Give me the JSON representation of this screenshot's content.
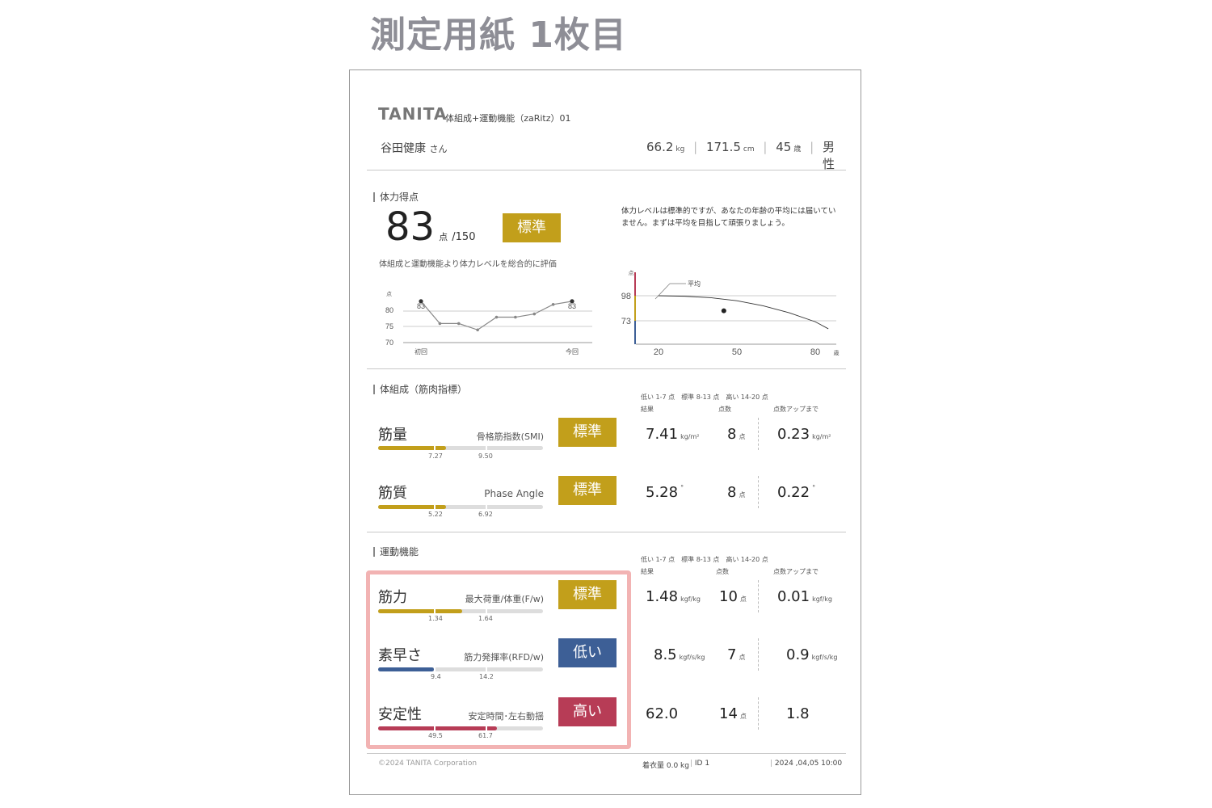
{
  "title": "測定用紙 1枚目",
  "header": {
    "brand": "TANITA",
    "product": "体組成+運動機能（zaRitz）01",
    "name": "谷田健康",
    "honorific": "さん",
    "weight": "66.2",
    "weight_unit": "kg",
    "height": "171.5",
    "height_unit": "cm",
    "age": "45",
    "age_unit": "歳",
    "sex": "男性"
  },
  "score": {
    "section": "体力得点",
    "value": "83",
    "unit": "点",
    "max": "/150",
    "badge": "標準",
    "desc": "体組成と運動機能より体力レベルを総合的に評価",
    "comment": "体力レベルは標準的ですが、あなたの年齢の平均には届いていません。まずは平均を目指して頑張りましょう。"
  },
  "chart_data": [
    {
      "type": "line",
      "ylabel": "点",
      "ylim": [
        70,
        85
      ],
      "yticks": [
        "80",
        "75",
        "70"
      ],
      "x_first": "初回",
      "x_last": "今回",
      "label_first": "83",
      "label_last": "83",
      "values": [
        83,
        76,
        76,
        74,
        78,
        78,
        79,
        82,
        83
      ],
      "color": "#888888"
    },
    {
      "type": "line",
      "ylabel": "点",
      "xlabel": "歳",
      "xticks": [
        "20",
        "50",
        "80"
      ],
      "yticks": [
        "98",
        "73"
      ],
      "xlim": [
        15,
        85
      ],
      "ylim": [
        48,
        122
      ],
      "annotation": "平均",
      "series": [
        {
          "x": [
            20,
            30,
            40,
            50,
            60,
            70,
            80,
            85
          ],
          "values": [
            98,
            97.5,
            96,
            93,
            88,
            81,
            72,
            65
          ]
        }
      ],
      "point": {
        "x": 45,
        "y": 83
      },
      "band_colors": [
        "#b73c56",
        "#c29f1b",
        "#3d5f96"
      ]
    }
  ],
  "body": {
    "section": "体組成（筋肉指標）",
    "legend": "低い 1-7 点　標準 8-13 点　高い 14-20 点",
    "col_result": "結果",
    "col_points": "点数",
    "col_up": "点数アップまで",
    "rows": [
      {
        "name": "筋量",
        "sub": "骨格筋指数(SMI)",
        "badge": "標準",
        "t1": "7.27",
        "t2": "9.50",
        "fill": 0.41,
        "result": "7.41",
        "result_unit": "kg/m²",
        "points": "8",
        "points_unit": "点",
        "up": "0.23",
        "up_unit": "kg/m²"
      },
      {
        "name": "筋質",
        "sub": "Phase Angle",
        "badge": "標準",
        "t1": "5.22",
        "t2": "6.92",
        "fill": 0.41,
        "result": "5.28",
        "result_unit": "°",
        "points": "8",
        "points_unit": "点",
        "up": "0.22",
        "up_unit": "°"
      }
    ]
  },
  "motor": {
    "section": "運動機能",
    "legend": "低い 1-7 点　標準 8-13 点　高い 14-20 点",
    "col_result": "結果",
    "col_points": "点数",
    "col_up": "点数アップまで",
    "rows": [
      {
        "name": "筋力",
        "sub": "最大荷重/体重(F/w)",
        "badge": "標準",
        "t1": "1.34",
        "t2": "1.64",
        "fill": 0.51,
        "result": "1.48",
        "result_unit": "kgf/kg",
        "points": "10",
        "points_unit": "点",
        "up": "0.01",
        "up_unit": "kgf/kg"
      },
      {
        "name": "素早さ",
        "sub": "筋力発揮率(RFD/w)",
        "badge": "低い",
        "t1": "9.4",
        "t2": "14.2",
        "fill": 0.34,
        "result": "8.5",
        "result_unit": "kgf/s/kg",
        "points": "7",
        "points_unit": "点",
        "up": "0.9",
        "up_unit": "kgf/s/kg"
      },
      {
        "name": "安定性",
        "sub": "安定時間･左右動揺",
        "badge": "高い",
        "t1": "49.5",
        "t2": "61.7",
        "fill": 0.72,
        "result": "62.0",
        "result_unit": "",
        "points": "14",
        "points_unit": "点",
        "up": "1.8",
        "up_unit": ""
      }
    ]
  },
  "footer": {
    "copyright": "©2024 TANITA Corporation",
    "clothes": "着衣量  0.0 kg",
    "id": "ID 1",
    "datetime": "2024 ,04,05  10:00"
  },
  "colors": {
    "standard": "#c29f1b",
    "low": "#3d5f96",
    "high": "#b73c56",
    "highlight": "#f2b3b3"
  }
}
